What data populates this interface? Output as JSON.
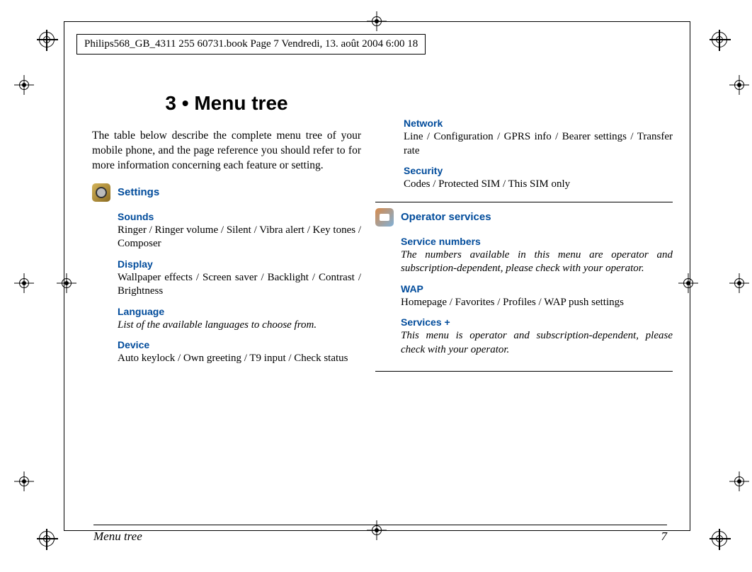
{
  "header_stamp": "Philips568_GB_4311 255 60731.book  Page 7  Vendredi, 13. août 2004  6:00 18",
  "title": "3 • Menu tree",
  "intro": "The table below describe the complete menu tree of your mobile phone, and the page reference you should refer to for more information concerning each feature or setting.",
  "settings": {
    "heading": "Settings",
    "sounds": {
      "label": "Sounds",
      "desc": "Ringer / Ringer volume / Silent / Vibra alert / Key tones / Composer"
    },
    "display": {
      "label": "Display",
      "desc": "Wallpaper effects / Screen saver / Backlight / Contrast / Brightness"
    },
    "language": {
      "label": "Language",
      "desc": "List of the available languages to choose from."
    },
    "device": {
      "label": "Device",
      "desc": "Auto keylock / Own greeting / T9 input / Check status"
    },
    "network": {
      "label": "Network",
      "desc": "Line / Configuration / GPRS info / Bearer settings / Transfer rate"
    },
    "security": {
      "label": "Security",
      "desc": "Codes / Protected SIM / This SIM only"
    }
  },
  "operator": {
    "heading": "Operator services",
    "service_numbers": {
      "label": "Service numbers",
      "desc": "The numbers available in this menu are operator and subscription-dependent, please check with your operator."
    },
    "wap": {
      "label": "WAP",
      "desc": "Homepage / Favorites / Profiles / WAP push settings"
    },
    "services_plus": {
      "label": "Services +",
      "desc": "This menu is operator and subscription-dependent, please check with your operator."
    }
  },
  "footer": {
    "section": "Menu tree",
    "page": "7"
  }
}
